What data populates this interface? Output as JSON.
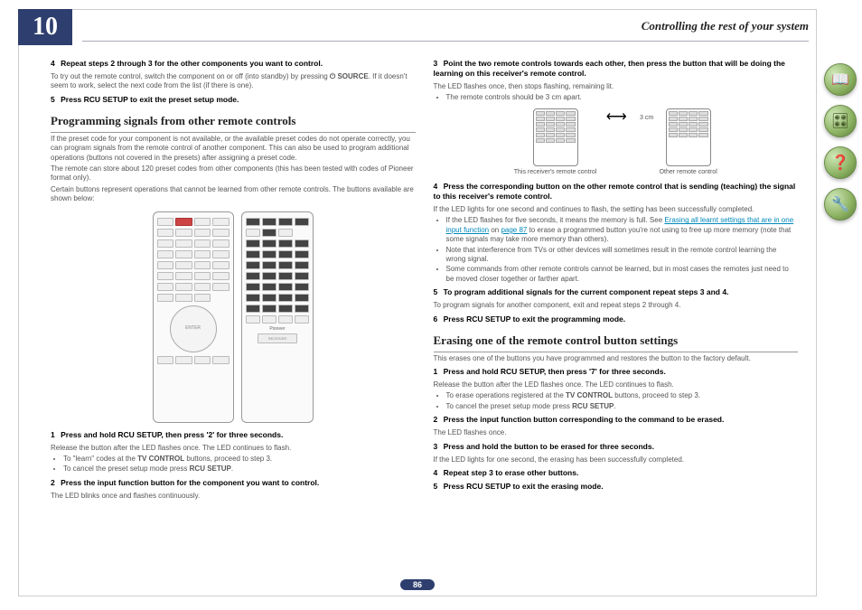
{
  "chapter_number": "10",
  "header_title": "Controlling the rest of your system",
  "page_number": "86",
  "left": {
    "s4_num": "4",
    "s4_title": "Repeat steps 2 through 3 for the other components you want to control.",
    "s4_body_a": "To try out the remote control, switch the component on or off (into standby) by pressing ",
    "s4_source": "⏻ SOURCE",
    "s4_body_b": ". If it doesn't seem to work, select the next code from the list (if there is one).",
    "s5_num": "5",
    "s5_title": "Press RCU SETUP to exit the preset setup mode.",
    "h2a": "Programming signals from other remote controls",
    "p1": "If the preset code for your component is not available, or the available preset codes do not operate correctly, you can program signals from the remote control of another component. This can also be used to program additional operations (buttons not covered in the presets) after assigning a preset code.",
    "p2": "The remote can store about 120 preset codes from other components (this has been tested with codes of Pioneer format only).",
    "p3": "Certain buttons represent operations that cannot be learned from other remote controls. The buttons available are shown below:",
    "rlogo": "Pioneer",
    "rrecv": "RECEIVER",
    "ps1_num": "1",
    "ps1_title": "Press and hold RCU SETUP, then press '2' for three seconds.",
    "ps1_body": "Release the button after the LED flashes once. The LED continues to flash.",
    "ps1_li1_a": "To \"learn\" codes at the ",
    "ps1_li1_b": "TV CONTROL",
    "ps1_li1_c": " buttons, proceed to step 3.",
    "ps1_li2_a": "To cancel the preset setup mode press ",
    "ps1_li2_b": "RCU SETUP",
    "ps1_li2_c": ".",
    "ps2_num": "2",
    "ps2_title": "Press the input function button for the component you want to control.",
    "ps2_body": "The LED blinks once and flashes continuously."
  },
  "right": {
    "s3_num": "3",
    "s3_title": "Point the two remote controls towards each other, then press the button that will be doing the learning on this receiver's remote control.",
    "s3_body": "The LED flashes once, then stops flashing, remaining lit.",
    "s3_li1": "The remote controls should be 3 cm apart.",
    "rc_this": "This receiver's remote control",
    "rc_dist": "3 cm",
    "rc_other": "Other remote control",
    "s4_num": "4",
    "s4_title": "Press the corresponding button on the other remote control that is sending (teaching) the signal to this receiver's remote control.",
    "s4_body": "If the LED lights for one second and continues to flash, the setting has been successfully completed.",
    "s4_li1_a": "If the LED flashes for five seconds, it means the memory is full. See ",
    "s4_li1_link": "Erasing all learnt settings that are in one input function",
    "s4_li1_b": " on ",
    "s4_li1_pg": "page 87",
    "s4_li1_c": " to erase a programmed button you're not using to free up more memory (note that some signals may take more memory than others).",
    "s4_li2": "Note that interference from TVs or other devices will sometimes result in the remote control learning the wrong signal.",
    "s4_li3": "Some commands from other remote controls cannot be learned, but in most cases the remotes just need to be moved closer together or farther apart.",
    "s5_num": "5",
    "s5_title": "To program additional signals for the current component repeat steps 3 and 4.",
    "s5_body": "To program signals for another component, exit and repeat steps 2 through 4.",
    "s6_num": "6",
    "s6_title": "Press RCU SETUP to exit the programming mode.",
    "h2b": "Erasing one of the remote control button settings",
    "e_intro": "This erases one of the buttons you have programmed and restores the button to the factory default.",
    "e1_num": "1",
    "e1_title": "Press and hold RCU SETUP, then press '7' for three seconds.",
    "e1_body": "Release the button after the LED flashes once. The LED continues to flash.",
    "e1_li1_a": "To erase operations registered at the ",
    "e1_li1_b": "TV CONTROL",
    "e1_li1_c": " buttons, proceed to step 3.",
    "e1_li2_a": "To cancel the preset setup mode press ",
    "e1_li2_b": "RCU SETUP",
    "e1_li2_c": ".",
    "e2_num": "2",
    "e2_title": "Press the input function button corresponding to the command to be erased.",
    "e2_body": "The LED flashes once.",
    "e3_num": "3",
    "e3_title": "Press and hold the button to be erased for three seconds.",
    "e3_body": "If the LED lights for one second, the erasing has been successfully completed.",
    "e4_num": "4",
    "e4_title": "Repeat step 3 to erase other buttons.",
    "e5_num": "5",
    "e5_title": "Press RCU SETUP to exit the erasing mode."
  },
  "icons": {
    "book": "📖",
    "component": "🎛",
    "help": "❓",
    "setup": "🔧"
  }
}
